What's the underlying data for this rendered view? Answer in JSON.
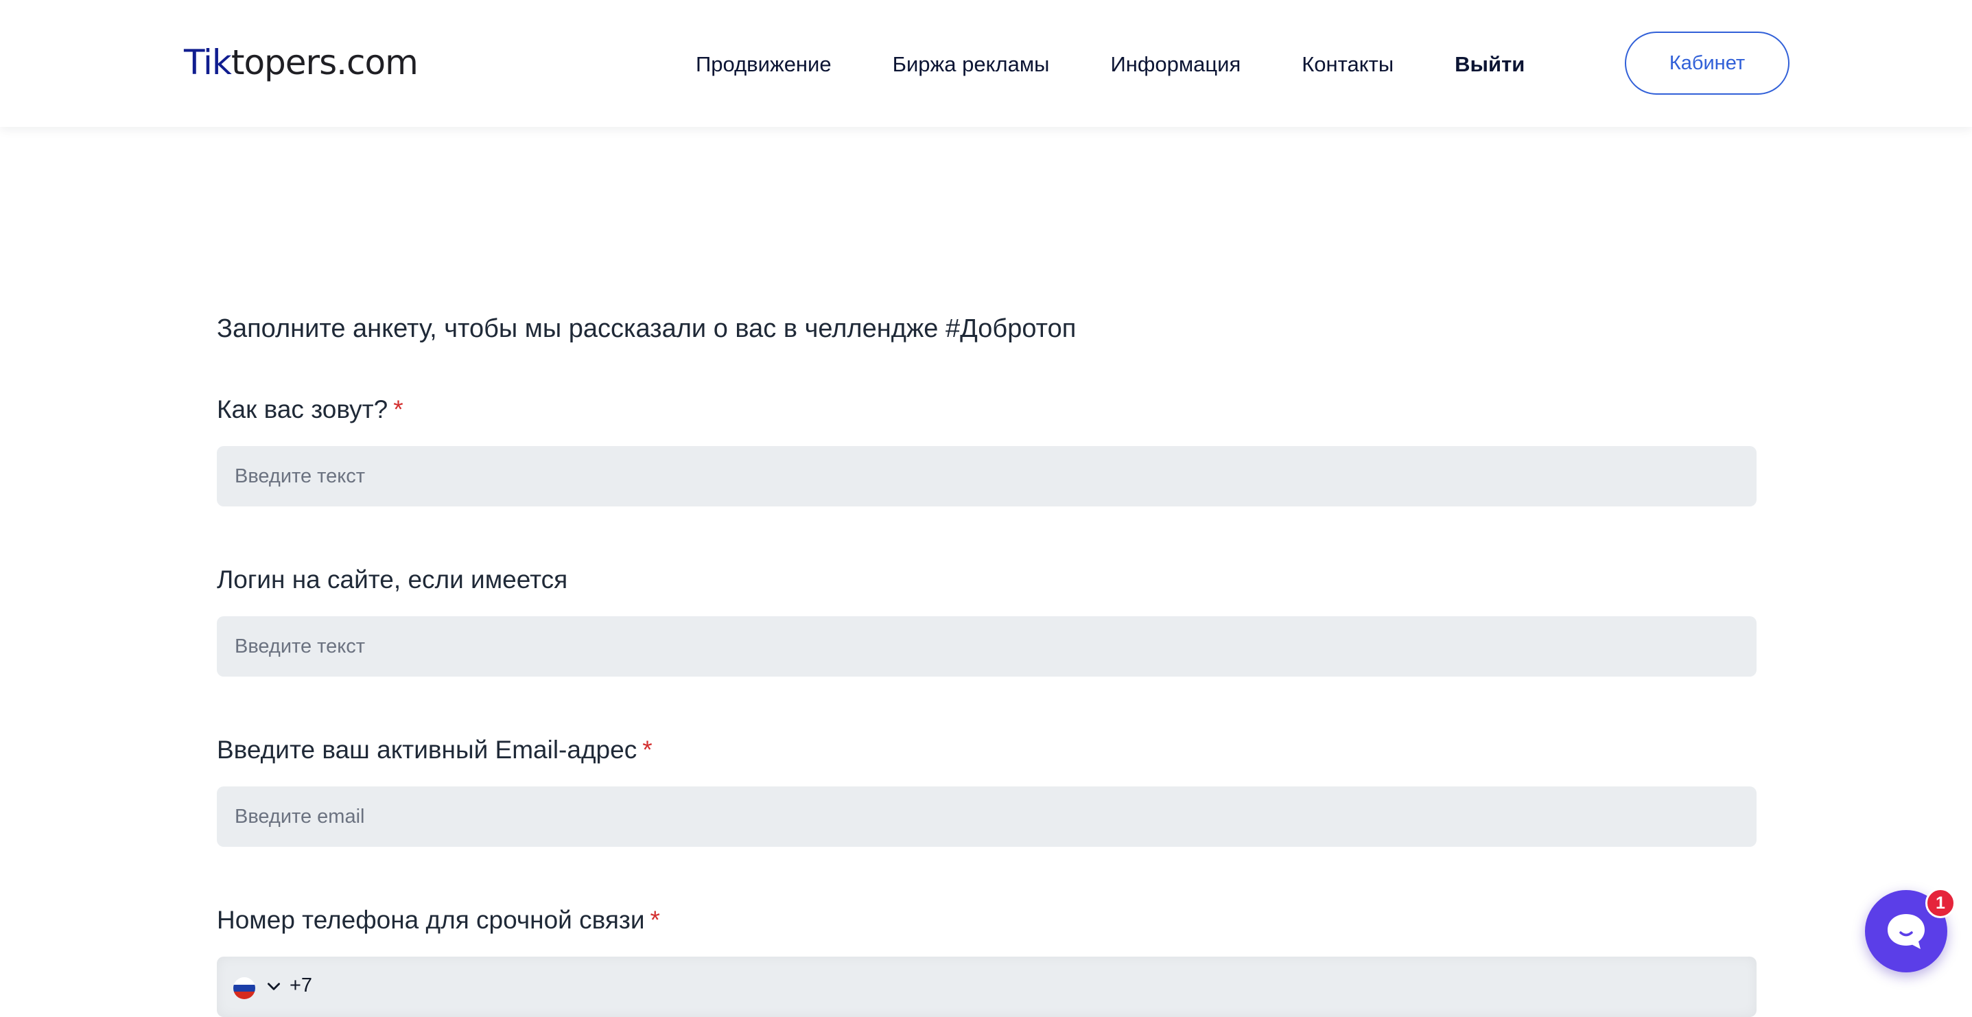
{
  "header": {
    "logo": {
      "accent": "Tik",
      "rest": "topers.com"
    },
    "nav": [
      {
        "label": "Продвижение"
      },
      {
        "label": "Биржа рекламы"
      },
      {
        "label": "Информация"
      },
      {
        "label": "Контакты"
      },
      {
        "label": "Выйти"
      }
    ],
    "cabinet_label": "Кабинет"
  },
  "form": {
    "intro": "Заполните анкету, чтобы мы рассказали о вас в челлендже #Добротоп",
    "required_mark": "*",
    "fields": [
      {
        "label": "Как вас зовут?",
        "placeholder": "Введите текст",
        "value": ""
      },
      {
        "label": "Логин на сайте, если имеется",
        "placeholder": "Введите текст",
        "value": ""
      },
      {
        "label": "Введите ваш активный Email-адрес",
        "placeholder": "Введите email",
        "value": ""
      },
      {
        "label": "Номер телефона для срочной связи",
        "country_code": "+7",
        "value": ""
      }
    ]
  },
  "chat": {
    "badge_count": "1"
  },
  "colors": {
    "accent": "#3160d8",
    "logo_accent": "#101d8f",
    "input_bg": "#eaedf0",
    "required": "#d32f2f",
    "chat_bg": "#5b3ee8",
    "badge_bg": "#e5243b"
  },
  "icons": {
    "flag": "russia-flag-icon",
    "chevron": "chevron-down-icon",
    "chat": "chat-bubble-icon"
  }
}
